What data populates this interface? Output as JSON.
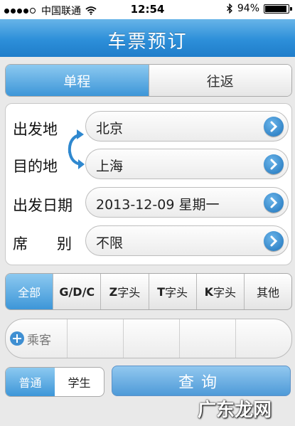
{
  "status": {
    "carrier": "中国联通",
    "time": "12:54",
    "battery": "94%",
    "battery_level": 0.94
  },
  "header": {
    "title": "车票预订"
  },
  "trip_type": {
    "one_way": "单程",
    "round_trip": "往返",
    "selected": "单程"
  },
  "form": {
    "from_label": "出发地",
    "from_value": "北京",
    "to_label": "目的地",
    "to_value": "上海",
    "date_label": "出发日期",
    "date_value": "2013-12-09 星期一",
    "seat_label_1": "席",
    "seat_label_2": "别",
    "seat_value": "不限"
  },
  "train_types": {
    "all": "全部",
    "gdc": "G/D/C",
    "z_letter": "Z",
    "t_letter": "T",
    "k_letter": "K",
    "suffix": "字头",
    "other": "其他",
    "selected": "全部"
  },
  "passenger": {
    "add_label": "乘客"
  },
  "ticket_kind": {
    "normal": "普通",
    "student": "学生",
    "selected": "普通"
  },
  "actions": {
    "query": "查询"
  },
  "watermark": "广东龙网",
  "colors": {
    "accent": "#2d8fd9",
    "selected_tab": "#3d96d8"
  }
}
